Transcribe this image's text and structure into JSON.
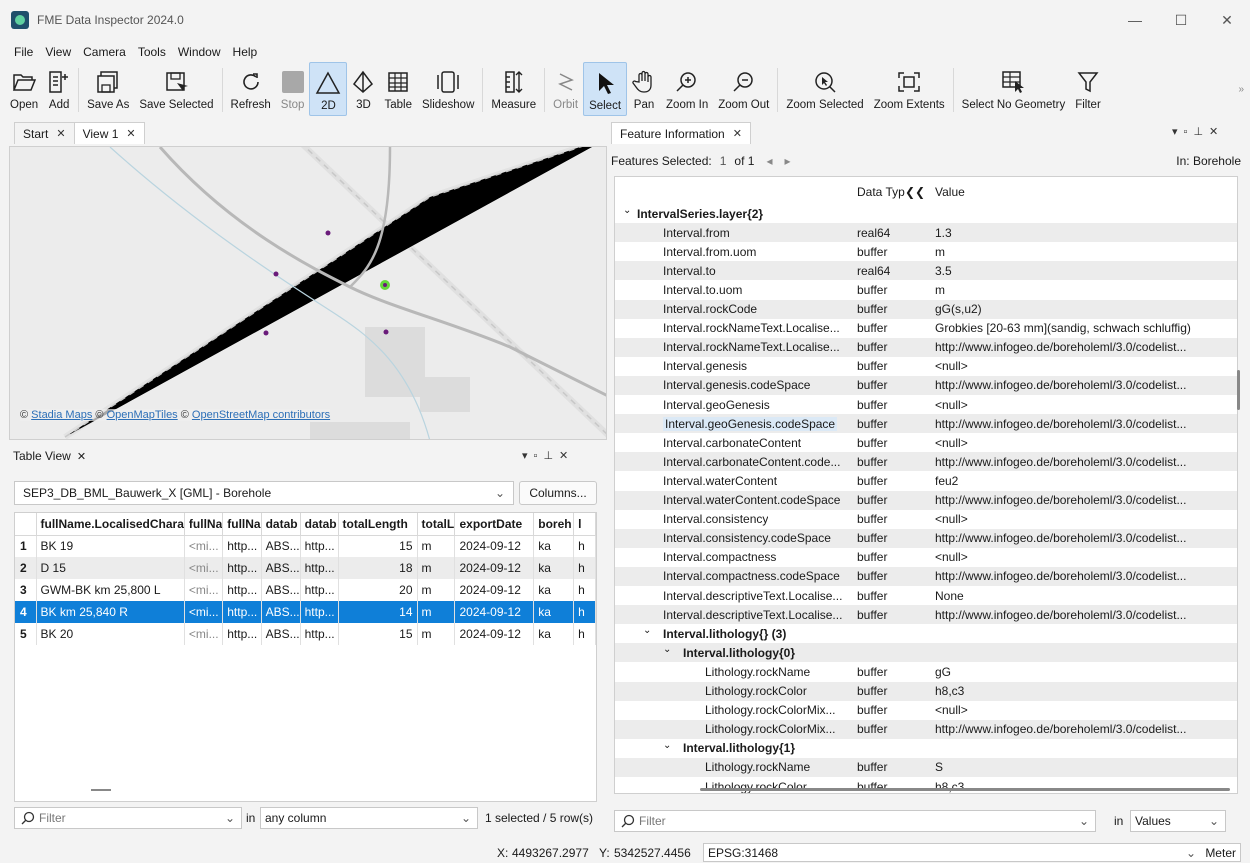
{
  "window": {
    "title": "FME Data Inspector 2024.0",
    "minimize": "—",
    "maximize": "☐",
    "close": "✕"
  },
  "menu": [
    "File",
    "View",
    "Camera",
    "Tools",
    "Window",
    "Help"
  ],
  "toolbar": {
    "open": "Open",
    "add": "Add",
    "save_as": "Save As",
    "save_selected": "Save Selected",
    "refresh": "Refresh",
    "stop": "Stop",
    "view2d": "2D",
    "view3d": "3D",
    "table": "Table",
    "slideshow": "Slideshow",
    "measure": "Measure",
    "orbit": "Orbit",
    "select": "Select",
    "pan": "Pan",
    "zoom_in": "Zoom In",
    "zoom_out": "Zoom Out",
    "zoom_selected": "Zoom Selected",
    "zoom_extents": "Zoom Extents",
    "select_no_geometry": "Select No Geometry",
    "filter": "Filter",
    "overflow": "»"
  },
  "view_tabs": [
    {
      "label": "Start",
      "close": "✕"
    },
    {
      "label": "View 1",
      "close": "✕"
    }
  ],
  "map": {
    "attribution_prefix": "©",
    "links": [
      "Stadia Maps",
      "OpenMapTiles",
      "OpenStreetMap contributors"
    ]
  },
  "table_view": {
    "title": "Table View",
    "close": "✕",
    "dataset": "SEP3_DB_BML_Bauwerk_X [GML] - Borehole",
    "columns_button": "Columns...",
    "headers": [
      "fullName.LocalisedChara",
      "fullNa",
      "fullNa",
      "datab",
      "datab",
      "totalLength",
      "totalL",
      "exportDate",
      "boreh",
      "l"
    ],
    "rows": [
      {
        "n": "1",
        "cells": [
          "BK 19",
          "<mi...",
          "http...",
          "ABS...",
          "http...",
          "15",
          "m",
          "2024-09-12",
          "ka",
          "h"
        ]
      },
      {
        "n": "2",
        "cells": [
          "D 15",
          "<mi...",
          "http...",
          "ABS...",
          "http...",
          "18",
          "m",
          "2024-09-12",
          "ka",
          "h"
        ]
      },
      {
        "n": "3",
        "cells": [
          "GWM-BK km 25,800 L",
          "<mi...",
          "http...",
          "ABS...",
          "http...",
          "20",
          "m",
          "2024-09-12",
          "ka",
          "h"
        ]
      },
      {
        "n": "4",
        "cells": [
          "BK km 25,840 R",
          "<mi...",
          "http...",
          "ABS...",
          "http...",
          "14",
          "m",
          "2024-09-12",
          "ka",
          "h"
        ]
      },
      {
        "n": "5",
        "cells": [
          "BK 20",
          "<mi...",
          "http...",
          "ABS...",
          "http...",
          "15",
          "m",
          "2024-09-12",
          "ka",
          "h"
        ]
      }
    ],
    "filter_placeholder": "Filter",
    "filter_in": "in",
    "filter_column": "any column",
    "selection_status": "1 selected / 5 row(s)"
  },
  "feature_info": {
    "title": "Feature Information",
    "close": "✕",
    "features_selected_label": "Features Selected:",
    "current": "1",
    "of_total": "of 1",
    "in_label": "In: Borehole",
    "col_type": "Data Typ",
    "col_value": "Value",
    "rows": [
      {
        "lvl": 0,
        "group": true,
        "name": "IntervalSeries.layer{2}"
      },
      {
        "lvl": 1,
        "name": "Interval.from",
        "type": "real64",
        "value": "1.3"
      },
      {
        "lvl": 1,
        "name": "Interval.from.uom",
        "type": "buffer",
        "value": "m"
      },
      {
        "lvl": 1,
        "name": "Interval.to",
        "type": "real64",
        "value": "3.5"
      },
      {
        "lvl": 1,
        "name": "Interval.to.uom",
        "type": "buffer",
        "value": "m"
      },
      {
        "lvl": 1,
        "name": "Interval.rockCode",
        "type": "buffer",
        "value": "gG(s,u2)"
      },
      {
        "lvl": 1,
        "name": "Interval.rockNameText.Localise...",
        "type": "buffer",
        "value": "Grobkies [20-63 mm](sandig, schwach schluffig)"
      },
      {
        "lvl": 1,
        "name": "Interval.rockNameText.Localise...",
        "type": "buffer",
        "value": "http://www.infogeo.de/boreholeml/3.0/codelist..."
      },
      {
        "lvl": 1,
        "name": "Interval.genesis",
        "type": "buffer",
        "value": "<null>"
      },
      {
        "lvl": 1,
        "name": "Interval.genesis.codeSpace",
        "type": "buffer",
        "value": "http://www.infogeo.de/boreholeml/3.0/codelist..."
      },
      {
        "lvl": 1,
        "name": "Interval.geoGenesis",
        "type": "buffer",
        "value": "<null>"
      },
      {
        "lvl": 1,
        "name": "Interval.geoGenesis.codeSpace",
        "type": "buffer",
        "value": "http://www.infogeo.de/boreholeml/3.0/codelist...",
        "hl": true
      },
      {
        "lvl": 1,
        "name": "Interval.carbonateContent",
        "type": "buffer",
        "value": "<null>"
      },
      {
        "lvl": 1,
        "name": "Interval.carbonateContent.code...",
        "type": "buffer",
        "value": "http://www.infogeo.de/boreholeml/3.0/codelist..."
      },
      {
        "lvl": 1,
        "name": "Interval.waterContent",
        "type": "buffer",
        "value": "feu2"
      },
      {
        "lvl": 1,
        "name": "Interval.waterContent.codeSpace",
        "type": "buffer",
        "value": "http://www.infogeo.de/boreholeml/3.0/codelist..."
      },
      {
        "lvl": 1,
        "name": "Interval.consistency",
        "type": "buffer",
        "value": "<null>"
      },
      {
        "lvl": 1,
        "name": "Interval.consistency.codeSpace",
        "type": "buffer",
        "value": "http://www.infogeo.de/boreholeml/3.0/codelist..."
      },
      {
        "lvl": 1,
        "name": "Interval.compactness",
        "type": "buffer",
        "value": "<null>"
      },
      {
        "lvl": 1,
        "name": "Interval.compactness.codeSpace",
        "type": "buffer",
        "value": "http://www.infogeo.de/boreholeml/3.0/codelist..."
      },
      {
        "lvl": 1,
        "name": "Interval.descriptiveText.Localise...",
        "type": "buffer",
        "value": "None"
      },
      {
        "lvl": 1,
        "name": "Interval.descriptiveText.Localise...",
        "type": "buffer",
        "value": "http://www.infogeo.de/boreholeml/3.0/codelist..."
      },
      {
        "lvl": 1,
        "group": true,
        "name": "Interval.lithology{} (3)"
      },
      {
        "lvl": 2,
        "group": true,
        "name": "Interval.lithology{0}"
      },
      {
        "lvl": 3,
        "name": "Lithology.rockName",
        "type": "buffer",
        "value": "gG"
      },
      {
        "lvl": 3,
        "name": "Lithology.rockColor",
        "type": "buffer",
        "value": "h8,c3"
      },
      {
        "lvl": 3,
        "name": "Lithology.rockColorMix...",
        "type": "buffer",
        "value": "<null>"
      },
      {
        "lvl": 3,
        "name": "Lithology.rockColorMix...",
        "type": "buffer",
        "value": "http://www.infogeo.de/boreholeml/3.0/codelist..."
      },
      {
        "lvl": 2,
        "group": true,
        "name": "Interval.lithology{1}"
      },
      {
        "lvl": 3,
        "name": "Lithology.rockName",
        "type": "buffer",
        "value": "S"
      },
      {
        "lvl": 3,
        "name": "Lithology.rockColor",
        "type": "buffer",
        "value": "h8,c3"
      }
    ],
    "filter_placeholder": "Filter",
    "filter_in": "in",
    "filter_scope": "Values"
  },
  "status": {
    "x_label": "X:",
    "x": "4493267.2977",
    "y_label": "Y:",
    "y": "5342527.4456",
    "epsg": "EPSG:31468",
    "unit": "Meter"
  },
  "colors": {
    "selection": "#0f7fd8",
    "accent": "#1f4f6b",
    "point": "#6a1b7a",
    "highlight": "#65d83a"
  }
}
